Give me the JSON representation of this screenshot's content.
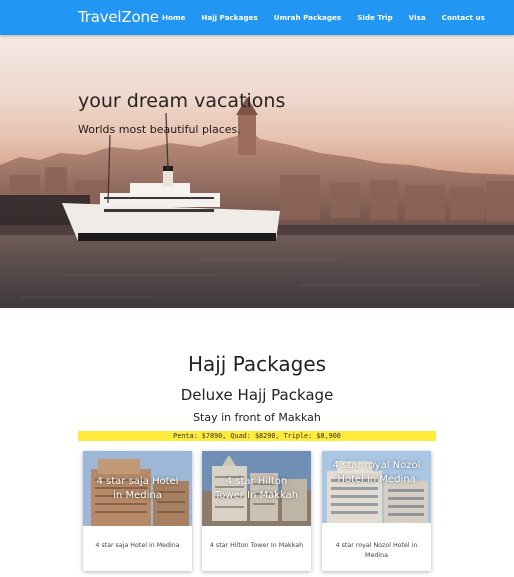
{
  "navbar": {
    "brand": "TravelZone",
    "links": [
      "Home",
      "Hajj Packages",
      "Umrah Packages",
      "Side Trip",
      "Visa",
      "Contact us"
    ]
  },
  "hero": {
    "title": "your dream vacations",
    "subtitle": "Worlds most beautiful places."
  },
  "packages": {
    "section_title": "Hajj Packages",
    "package_title": "Deluxe Hajj Package",
    "tagline": "Stay in front of Makkah",
    "prices": "Penta: $7890,   Quad: $8290,   Triple: $8,900"
  },
  "cards": [
    {
      "overlay": "4 star saja Hotel in Medina",
      "caption": "4 star saja Hotel in Medina"
    },
    {
      "overlay": "4 star Hilton Tower In Makkah",
      "caption": "4 star Hilton Tower In Makkah"
    },
    {
      "overlay": "4 star royal Nozol Hotel in Medina",
      "caption": "4 star royal Nozol Hotel in Medina"
    }
  ],
  "colors": {
    "navbar": "#2196f3",
    "price_bar": "#ffeb3b"
  }
}
